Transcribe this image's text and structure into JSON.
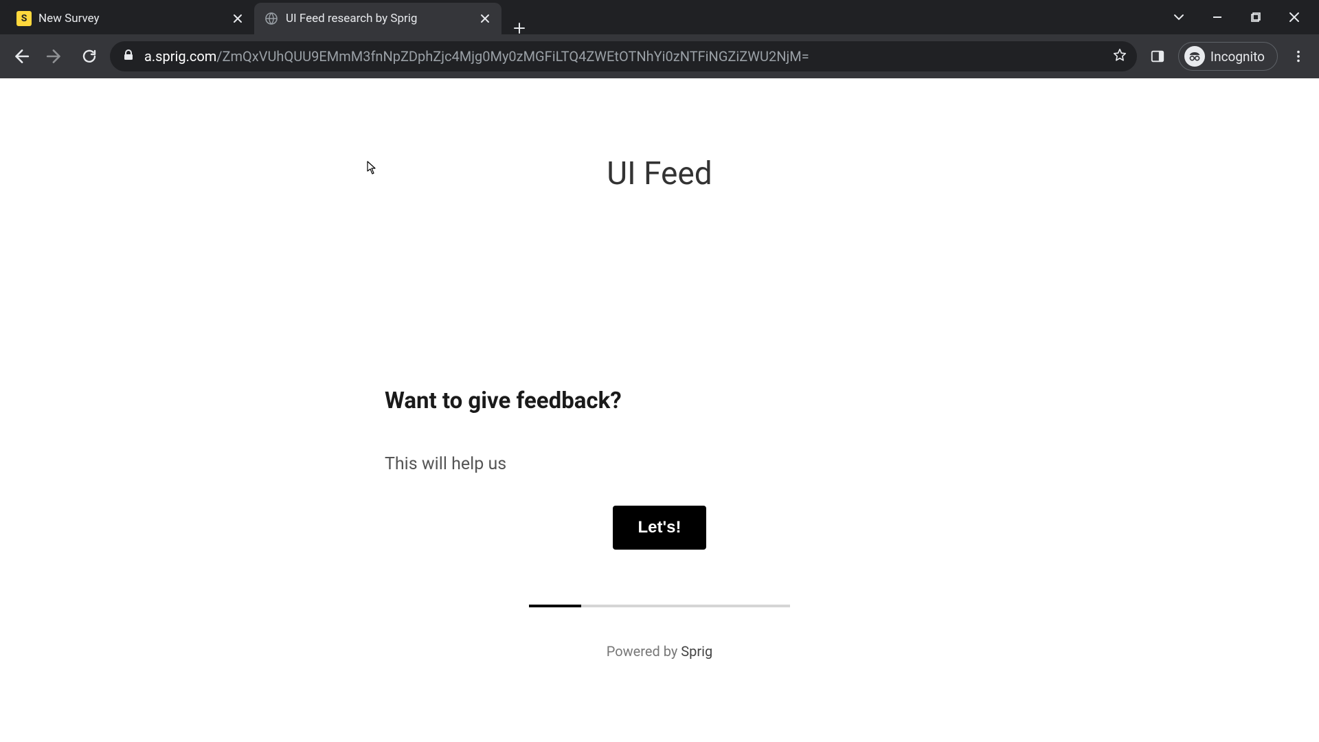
{
  "tabs": [
    {
      "title": "New Survey",
      "favicon_letter": "S"
    },
    {
      "title": "UI Feed research by Sprig"
    }
  ],
  "url": {
    "host": "a.sprig.com",
    "path": "/ZmQxVUhQUU9EMmM3fnNpZDphZjc4Mjg0My0zMGFiLTQ4ZWEtOTNhYi0zNTFiNGZiZWU2NjM="
  },
  "incognito_label": "Incognito",
  "page": {
    "title": "UI Feed",
    "question": "Want to give feedback?",
    "description": "This will help us",
    "button_label": "Let's!",
    "progress_percent": 20,
    "powered_prefix": "Powered by ",
    "powered_brand": "Sprig"
  }
}
